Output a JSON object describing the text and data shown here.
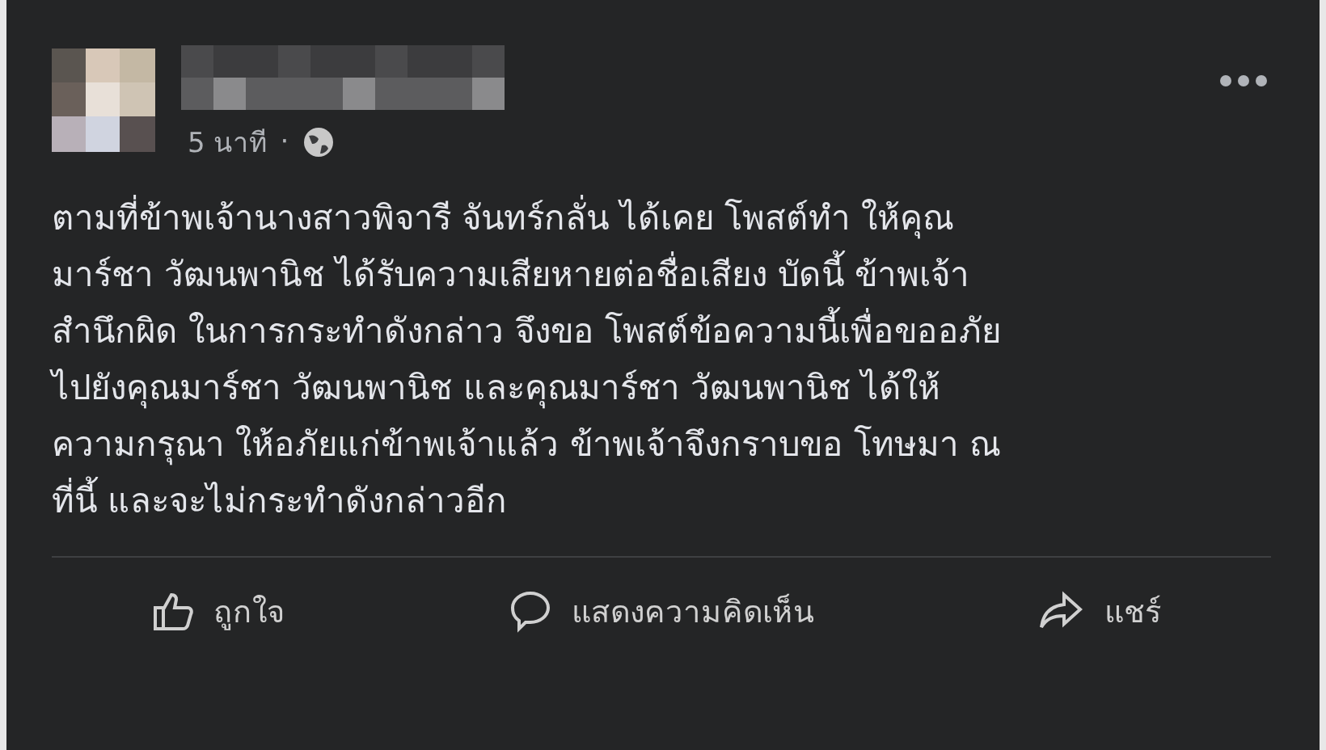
{
  "post": {
    "time": "5 นาที",
    "separator": "·",
    "body_lines": [
      "ตามที่ข้าพเจ้านางสาวพิจารี จันทร์กลั่น ได้เคย โพสต์ทำ ให้คุณ",
      "มาร์ชา วัฒนพานิช ได้รับความเสียหายต่อชื่อเสียง บัดนี้ ข้าพเจ้า",
      "สำนึกผิด ในการกระทำดังกล่าว จึงขอ โพสต์ข้อความนี้เพื่อขออภัย",
      "ไปยังคุณมาร์ชา วัฒนพานิช และคุณมาร์ชา วัฒนพานิช ได้ให้",
      "ความกรุณา ให้อภัยแก่ข้าพเจ้าแล้ว ข้าพเจ้าจึงกราบขอ โทษมา ณ",
      "ที่นี้ และจะไม่กระทำดังกล่าวอีก"
    ]
  },
  "actions": [
    {
      "kind": "like",
      "label": "ถูกใจ"
    },
    {
      "kind": "comment",
      "label": "แสดงความคิดเห็น"
    },
    {
      "kind": "share",
      "label": "แชร์"
    }
  ]
}
